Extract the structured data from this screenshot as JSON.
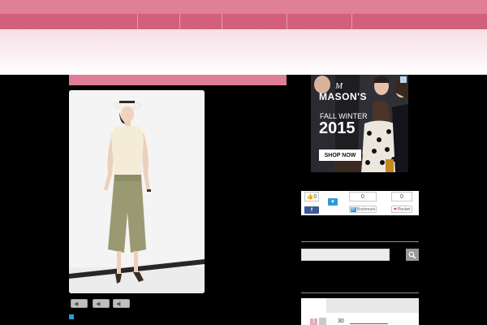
{
  "advert": {
    "brand": "MASON'S",
    "logo_letter": "M",
    "season": "FALL WINTER",
    "year": "2015",
    "cta": "SHOP NOW"
  },
  "share": {
    "like_count": "0",
    "bookmark_count": "0",
    "pocket_count": "0",
    "bookmark_label": "Bookmark",
    "pocket_label": "Pocket"
  },
  "ranking": {
    "first_rank": "1",
    "first_text": "30"
  },
  "colors": {
    "header_pink": "#e07f95",
    "nav_pink": "#d3607a",
    "accent_blue": "#2c9ad6"
  }
}
